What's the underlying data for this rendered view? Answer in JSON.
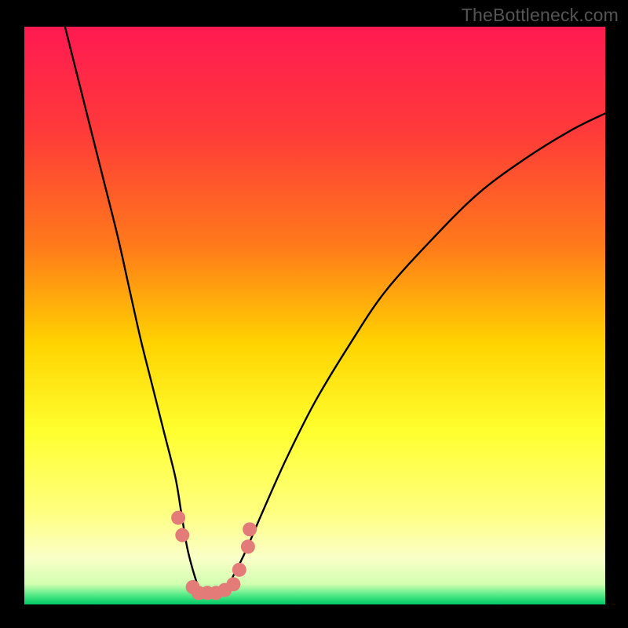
{
  "watermark": "TheBottleneck.com",
  "chart_data": {
    "type": "line",
    "title": "",
    "xlabel": "",
    "ylabel": "",
    "xlim": [
      0,
      100
    ],
    "ylim": [
      0,
      100
    ],
    "gradient_stops": [
      {
        "offset": 0.0,
        "color": "#ff1a52"
      },
      {
        "offset": 0.18,
        "color": "#ff3a3a"
      },
      {
        "offset": 0.38,
        "color": "#ff7a1a"
      },
      {
        "offset": 0.55,
        "color": "#ffd400"
      },
      {
        "offset": 0.7,
        "color": "#ffff2f"
      },
      {
        "offset": 0.84,
        "color": "#ffff80"
      },
      {
        "offset": 0.92,
        "color": "#faffc8"
      },
      {
        "offset": 0.965,
        "color": "#d2ffb0"
      },
      {
        "offset": 0.985,
        "color": "#4be884"
      },
      {
        "offset": 1.0,
        "color": "#00c866"
      }
    ],
    "series": [
      {
        "name": "bottleneck-curve",
        "x": [
          7,
          10,
          13,
          16,
          18,
          20,
          22,
          24,
          26,
          27,
          28,
          29,
          30,
          31,
          34,
          35,
          36,
          38,
          41,
          45,
          50,
          56,
          62,
          70,
          78,
          86,
          94,
          100
        ],
        "y": [
          100,
          88,
          76,
          64,
          55,
          46,
          38,
          30,
          22,
          16,
          10,
          6,
          3,
          2,
          2,
          3,
          5,
          9,
          16,
          25,
          35,
          45,
          54,
          63,
          71,
          77,
          82,
          85
        ]
      }
    ],
    "markers": {
      "name": "highlight-dots",
      "color": "#e37b78",
      "points": [
        {
          "x": 26.5,
          "y": 15
        },
        {
          "x": 27.2,
          "y": 12
        },
        {
          "x": 29.0,
          "y": 3
        },
        {
          "x": 30.0,
          "y": 2
        },
        {
          "x": 31.5,
          "y": 2
        },
        {
          "x": 33.0,
          "y": 2
        },
        {
          "x": 34.5,
          "y": 2.5
        },
        {
          "x": 36.0,
          "y": 3.5
        },
        {
          "x": 37.0,
          "y": 6
        },
        {
          "x": 38.5,
          "y": 10
        },
        {
          "x": 38.8,
          "y": 13
        }
      ]
    }
  }
}
